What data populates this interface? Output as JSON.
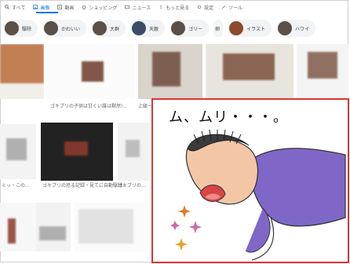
{
  "tabs": [
    {
      "label": "すべて",
      "icon": "search-icon"
    },
    {
      "label": "画像",
      "icon": "image-icon",
      "active": true
    },
    {
      "label": "動画",
      "icon": "video-icon"
    },
    {
      "label": "ショッピング",
      "icon": "shopping-icon"
    },
    {
      "label": "ニュース",
      "icon": "news-icon"
    },
    {
      "label": "もっと見る",
      "icon": "more-icon"
    },
    {
      "label": "設定",
      "icon": "settings-icon"
    },
    {
      "label": "ツール",
      "icon": "tools-icon"
    }
  ],
  "chips": [
    {
      "label": "駆除"
    },
    {
      "label": "かわいい"
    },
    {
      "label": "大群"
    },
    {
      "label": "天敵"
    },
    {
      "label": "ゴリー"
    },
    {
      "label": "卵"
    },
    {
      "label": "イラスト"
    },
    {
      "label": "ハワイ"
    }
  ],
  "grid_captions": [
    "ゴキブリの子供は甘くい誰は黙然!...",
    "上級ー...",
    "ゴキブリの恐る記録・見てに自動駆除...",
    "ゴキブリの...",
    "ミッ・この..."
  ],
  "overlay": {
    "title": "ム、ムリ・・・。"
  },
  "colors": {
    "accent": "#1a73e8",
    "overlay_border": "#d33"
  }
}
